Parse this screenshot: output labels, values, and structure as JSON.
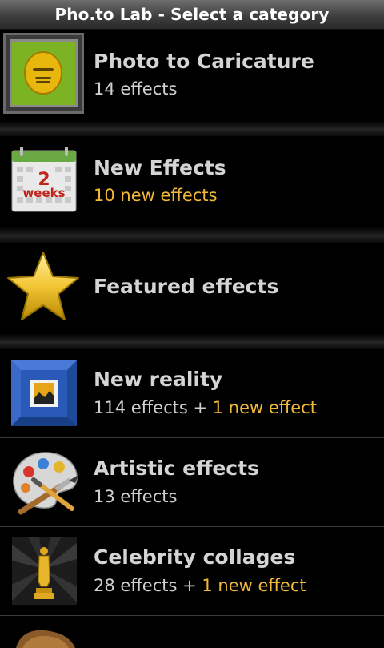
{
  "window": {
    "title": "Pho.to Lab - Select a category"
  },
  "categories": [
    {
      "title": "Photo to Caricature",
      "subtitle": "14 effects",
      "icon": "caricature-face-icon"
    },
    {
      "title": "New Effects",
      "subtitle_new": "10 new effects",
      "icon": "calendar-icon",
      "icon_text_number": "2",
      "icon_text_unit": "weeks"
    },
    {
      "title": "Featured effects",
      "icon": "star-icon"
    },
    {
      "title": "New reality",
      "subtitle": "114 effects",
      "subtitle_joiner": " + ",
      "subtitle_new": "1 new effect",
      "icon": "picture-frame-icon"
    },
    {
      "title": "Artistic effects",
      "subtitle": "13 effects",
      "icon": "palette-icon"
    },
    {
      "title": "Celebrity collages",
      "subtitle": "28 effects",
      "subtitle_joiner": " + ",
      "subtitle_new": "1 new effect",
      "icon": "oscar-statue-icon"
    }
  ],
  "colors": {
    "accent_new": "#f0b838",
    "background": "#000000",
    "text": "#d4d4d4"
  }
}
